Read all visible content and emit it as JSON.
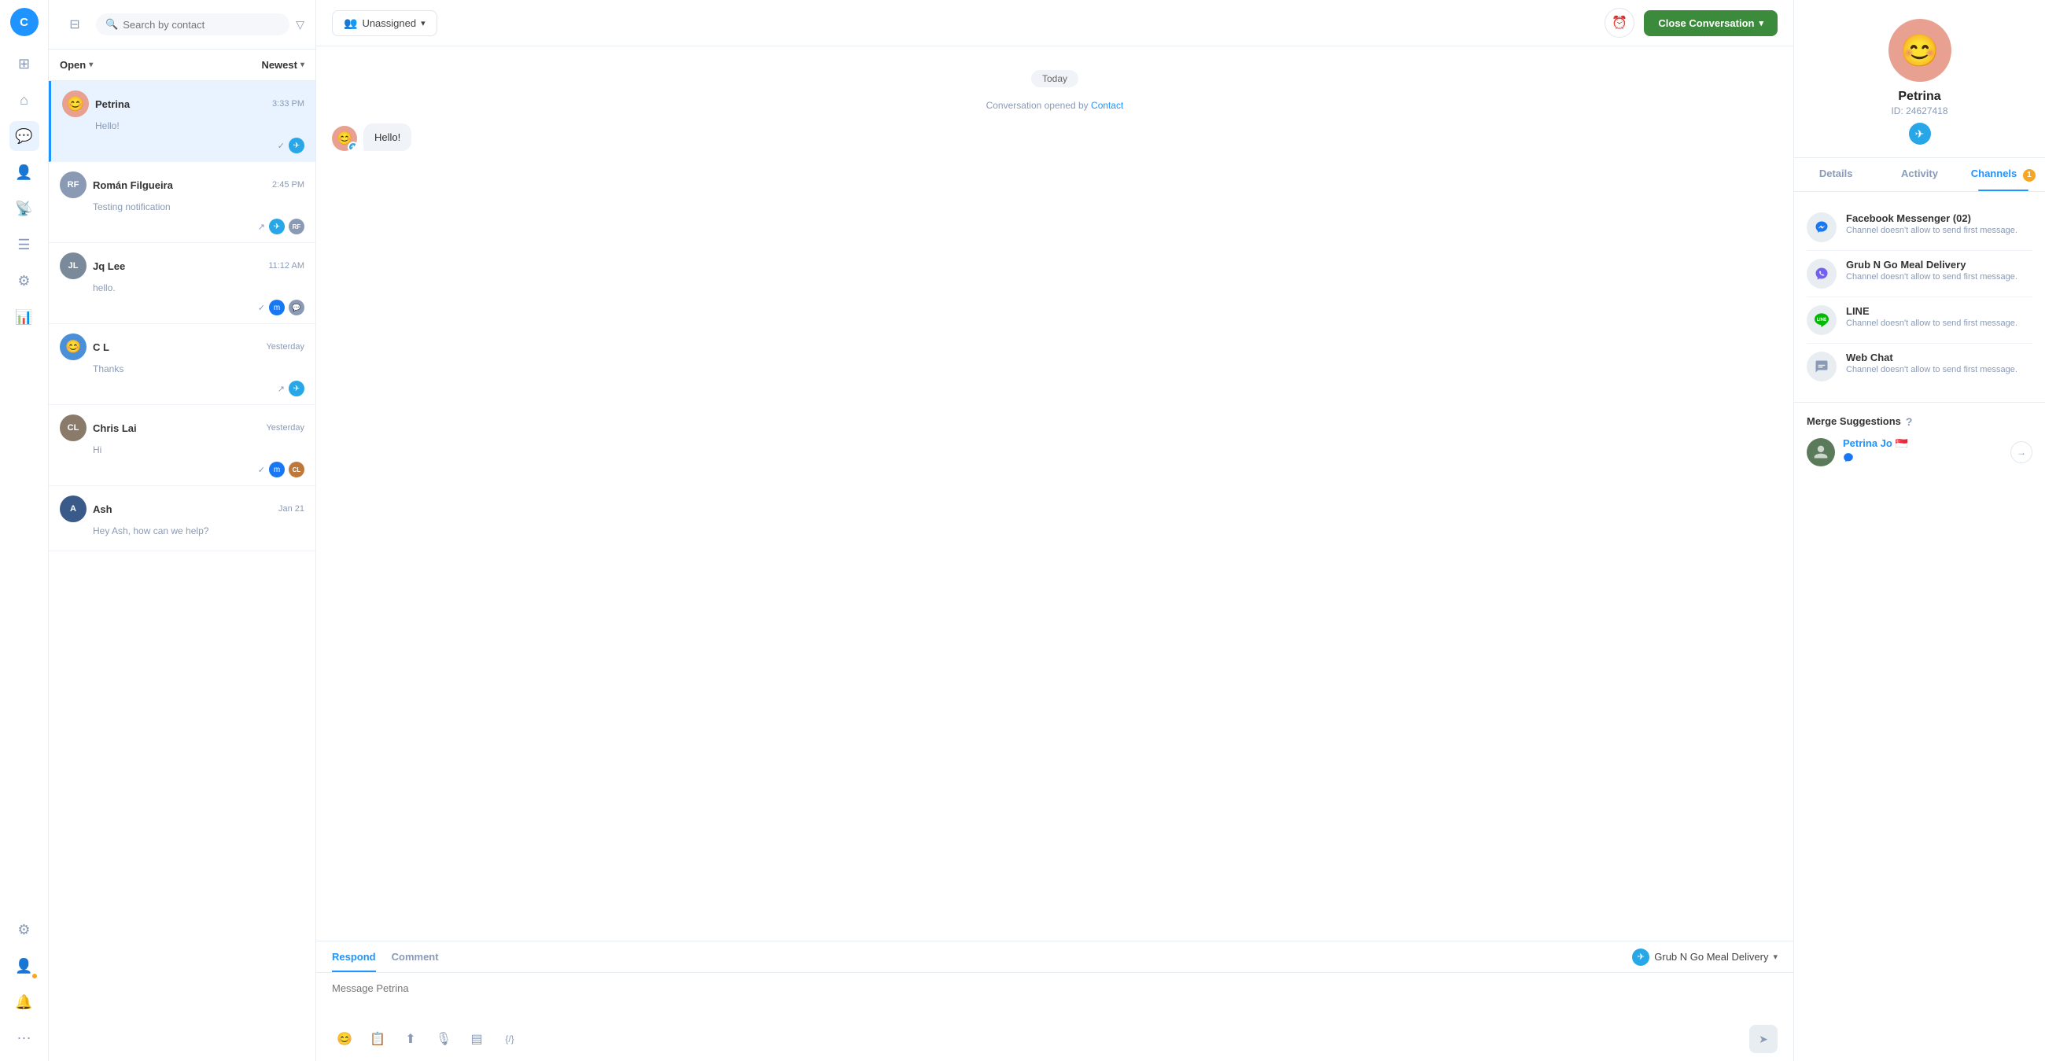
{
  "app": {
    "user_initial": "C",
    "user_bg": "#1f93ff"
  },
  "left_nav": {
    "icons": [
      {
        "name": "sidebar-toggle-icon",
        "symbol": "⊞",
        "active": false
      },
      {
        "name": "home-icon",
        "symbol": "⌂",
        "active": false
      },
      {
        "name": "conversations-icon",
        "symbol": "💬",
        "active": true
      },
      {
        "name": "contacts-icon",
        "symbol": "👤",
        "active": false
      },
      {
        "name": "reports-icon",
        "symbol": "📡",
        "active": false
      },
      {
        "name": "list-icon",
        "symbol": "☰",
        "active": false
      },
      {
        "name": "settings-icon",
        "symbol": "⚙",
        "active": false
      },
      {
        "name": "chart-icon",
        "symbol": "📊",
        "active": false
      },
      {
        "name": "settings2-icon",
        "symbol": "⚙",
        "active": false
      },
      {
        "name": "user-icon",
        "symbol": "👤",
        "active": false
      },
      {
        "name": "bell-icon",
        "symbol": "🔔",
        "active": false
      },
      {
        "name": "more-icon",
        "symbol": "⋯",
        "active": false
      }
    ]
  },
  "search": {
    "placeholder": "Search by contact",
    "filter_icon": "▽"
  },
  "filters": {
    "open_label": "Open",
    "newest_label": "Newest"
  },
  "conversations": [
    {
      "id": "petrina",
      "name": "Petrina",
      "time": "3:33 PM",
      "preview": "Hello!",
      "active": true,
      "avatar_color": "#e8a090",
      "avatar_emoji": "😊",
      "channels": [
        "telegram"
      ],
      "tick": true,
      "agents": []
    },
    {
      "id": "roman",
      "name": "Román Filgueira",
      "time": "2:45 PM",
      "preview": "Testing notification",
      "active": false,
      "avatar_color": "#8a9ab5",
      "avatar_img": true,
      "channels": [
        "telegram"
      ],
      "tick": false,
      "agents": [
        "agent1"
      ]
    },
    {
      "id": "jqlee",
      "name": "Jq Lee",
      "time": "11:12 AM",
      "preview": "hello.",
      "active": false,
      "avatar_color": "#7a8a9a",
      "channels": [
        "messenger",
        "webchat"
      ],
      "tick": true,
      "agents": []
    },
    {
      "id": "cl",
      "name": "C L",
      "time": "Yesterday",
      "preview": "Thanks",
      "active": false,
      "avatar_color": "#4a90d9",
      "avatar_emoji": "😊",
      "channels": [
        "telegram"
      ],
      "tick": false,
      "agents": []
    },
    {
      "id": "chrislai",
      "name": "Chris Lai",
      "time": "Yesterday",
      "preview": "Hi",
      "active": false,
      "avatar_color": "#8a7a6a",
      "channels": [
        "messenger"
      ],
      "tick": true,
      "agents": [
        "agent2"
      ]
    },
    {
      "id": "ash",
      "name": "Ash",
      "time": "Jan 21",
      "preview": "Hey Ash, how can we help?",
      "active": false,
      "avatar_color": "#3a5a8a",
      "channels": [],
      "tick": false,
      "agents": []
    }
  ],
  "chat": {
    "today_label": "Today",
    "system_msg": "Conversation opened by",
    "system_link": "Contact",
    "message": "Hello!",
    "assign_placeholder": "Unassigned",
    "close_btn": "Close Conversation",
    "tabs": [
      {
        "id": "respond",
        "label": "Respond",
        "active": true
      },
      {
        "id": "comment",
        "label": "Comment",
        "active": false
      }
    ],
    "channel_name": "Grub N Go Meal Delivery",
    "reply_placeholder": "Message Petrina"
  },
  "right_panel": {
    "contact_name": "Petrina",
    "contact_id": "ID: 24627418",
    "tabs": [
      {
        "id": "details",
        "label": "Details",
        "active": false
      },
      {
        "id": "activity",
        "label": "Activity",
        "active": false
      },
      {
        "id": "channels",
        "label": "Channels",
        "active": true,
        "badge": "1"
      }
    ],
    "channels": [
      {
        "id": "facebook",
        "icon_type": "messenger",
        "name": "Facebook Messenger (02)",
        "note": "Channel doesn't allow to send first message."
      },
      {
        "id": "viber",
        "icon_type": "viber",
        "name": "Grub N Go Meal Delivery",
        "note": "Channel doesn't allow to send first message."
      },
      {
        "id": "line",
        "icon_type": "line",
        "name": "LINE",
        "note": "Channel doesn't allow to send first message."
      },
      {
        "id": "webchat",
        "icon_type": "webchat",
        "name": "Web Chat",
        "note": "Channel doesn't allow to send first message."
      }
    ],
    "merge_title": "Merge Suggestions",
    "merge_contacts": [
      {
        "id": "petrina_jo",
        "name": "Petrina Jo 🇸🇬",
        "channel": "messenger"
      }
    ]
  }
}
